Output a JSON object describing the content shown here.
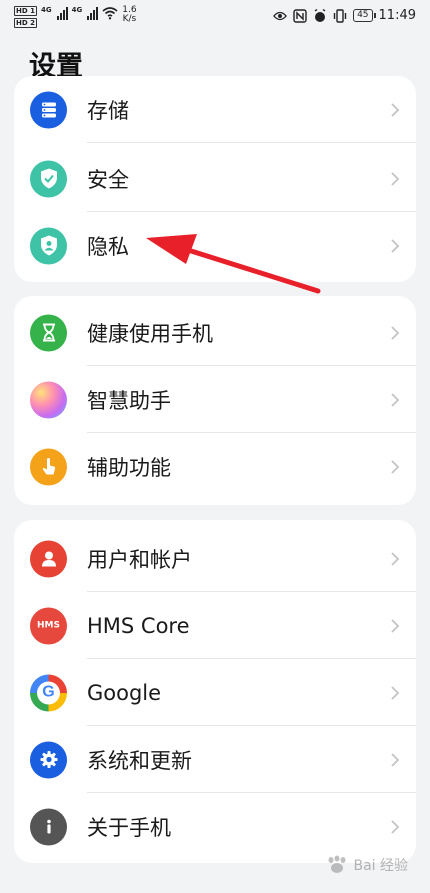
{
  "status_bar": {
    "hd1": "HD 1",
    "hd2": "HD 2",
    "net1": "4G",
    "net2": "4G",
    "speed_value": "1.6",
    "speed_unit": "K/s",
    "battery": "45",
    "time": "11:49"
  },
  "page": {
    "title": "设置"
  },
  "groups": [
    {
      "items": [
        {
          "label": "存储",
          "icon": "storage-icon",
          "color": "#1a5fe0"
        },
        {
          "label": "安全",
          "icon": "security-shield-icon",
          "color": "#3ec3a7"
        },
        {
          "label": "隐私",
          "icon": "privacy-shield-icon",
          "color": "#3ec3a7"
        }
      ]
    },
    {
      "items": [
        {
          "label": "健康使用手机",
          "icon": "hourglass-icon",
          "color": "#36b24a"
        },
        {
          "label": "智慧助手",
          "icon": "assistant-orb-icon",
          "color": "#c86cf0"
        },
        {
          "label": "辅助功能",
          "icon": "hand-touch-icon",
          "color": "#f5a21b"
        }
      ]
    },
    {
      "items": [
        {
          "label": "用户和帐户",
          "icon": "user-icon",
          "color": "#e64334"
        },
        {
          "label": "HMS Core",
          "icon": "hms-icon",
          "color": "#e6483d",
          "icon_text": "HMS"
        },
        {
          "label": "Google",
          "icon": "google-icon",
          "color": "#ffffff"
        },
        {
          "label": "系统和更新",
          "icon": "gear-icon",
          "color": "#1a5fe0"
        },
        {
          "label": "关于手机",
          "icon": "info-icon",
          "color": "#555555"
        }
      ]
    }
  ],
  "annotation": {
    "arrow_color": "#e8202a"
  },
  "watermark": {
    "text": "Bai 经验"
  }
}
